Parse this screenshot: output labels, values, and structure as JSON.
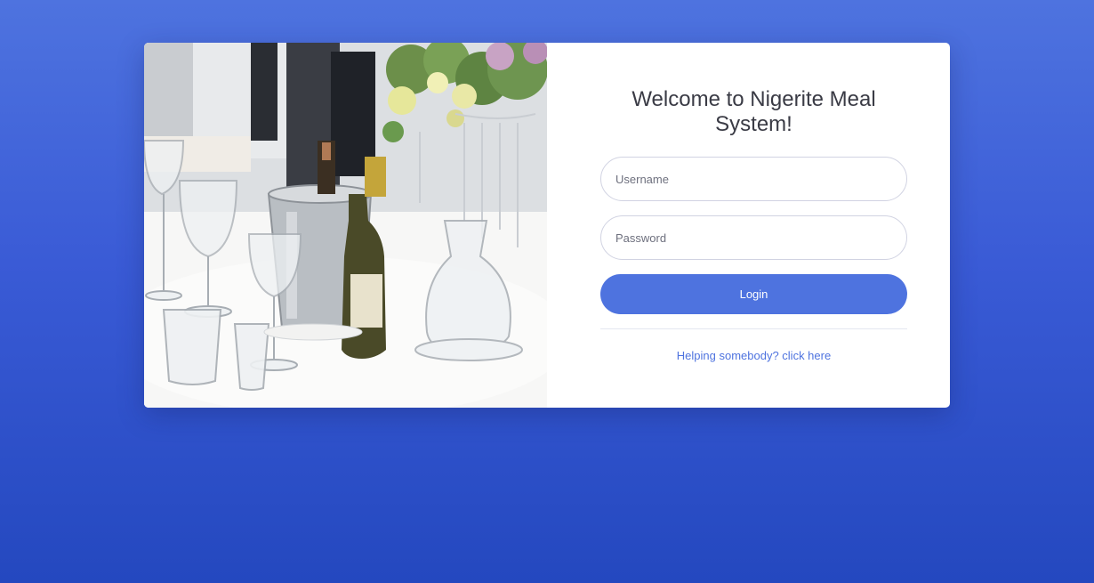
{
  "page": {
    "background_color": "#4e73df"
  },
  "login_card": {
    "image": {
      "description_icon": "dining-table-photo"
    },
    "title": "Welcome to Nigerite Meal System!",
    "username_placeholder": "Username",
    "password_placeholder": "Password",
    "login_label": "Login",
    "help_link_text": "Helping somebody? click here",
    "accent_color": "#4e73df"
  }
}
